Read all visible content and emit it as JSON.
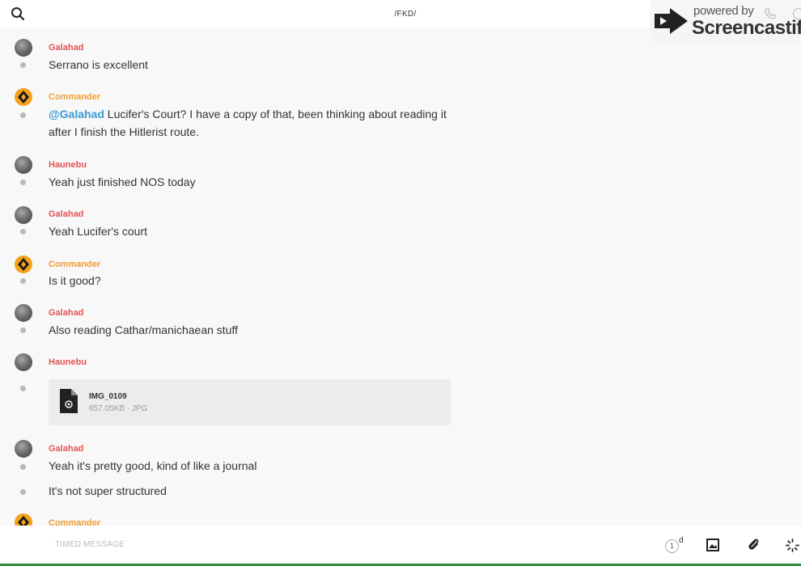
{
  "header": {
    "channel_title": "/FKD/",
    "search_icon": "search-icon"
  },
  "watermark": {
    "powered_by": "powered by",
    "brand": "Screencastify"
  },
  "messages": [
    {
      "author": "Galahad",
      "avatar": "gray",
      "author_color": "#e05555",
      "lines": [
        "Serrano is excellent"
      ]
    },
    {
      "author": "Commander",
      "avatar": "orange",
      "author_color": "#f39c32",
      "mention": "@Galahad",
      "lines": [
        "Lucifer's Court? I have a copy of that, been thinking about reading it after I finish the Hitlerist route."
      ]
    },
    {
      "author": "Haunebu",
      "avatar": "gray",
      "author_color": "#e05555",
      "lines": [
        "Yeah just finished NOS today"
      ]
    },
    {
      "author": "Galahad",
      "avatar": "gray",
      "author_color": "#e05555",
      "lines": [
        "Yeah Lucifer's court"
      ]
    },
    {
      "author": "Commander",
      "avatar": "orange",
      "author_color": "#f39c32",
      "lines": [
        "Is it good?"
      ]
    },
    {
      "author": "Galahad",
      "avatar": "gray",
      "author_color": "#e05555",
      "lines": [
        "Also reading Cathar/manichaean stuff"
      ]
    },
    {
      "author": "Haunebu",
      "avatar": "gray",
      "author_color": "#e05555",
      "attachment": {
        "name": "IMG_0109",
        "meta": "657.05KB · JPG"
      }
    },
    {
      "author": "Galahad",
      "avatar": "gray",
      "author_color": "#e05555",
      "lines": [
        "Yeah it's pretty good, kind of like a journal",
        "It's not super structured"
      ]
    },
    {
      "author": "Commander",
      "avatar": "orange",
      "author_color": "#f39c32",
      "lines": []
    }
  ],
  "composer": {
    "placeholder": "TIMED MESSAGE",
    "timer_value": "1",
    "timer_unit": "d"
  },
  "colors": {
    "accent_red": "#e05555",
    "accent_orange": "#f39c32",
    "mention_blue": "#3b9bd4"
  }
}
